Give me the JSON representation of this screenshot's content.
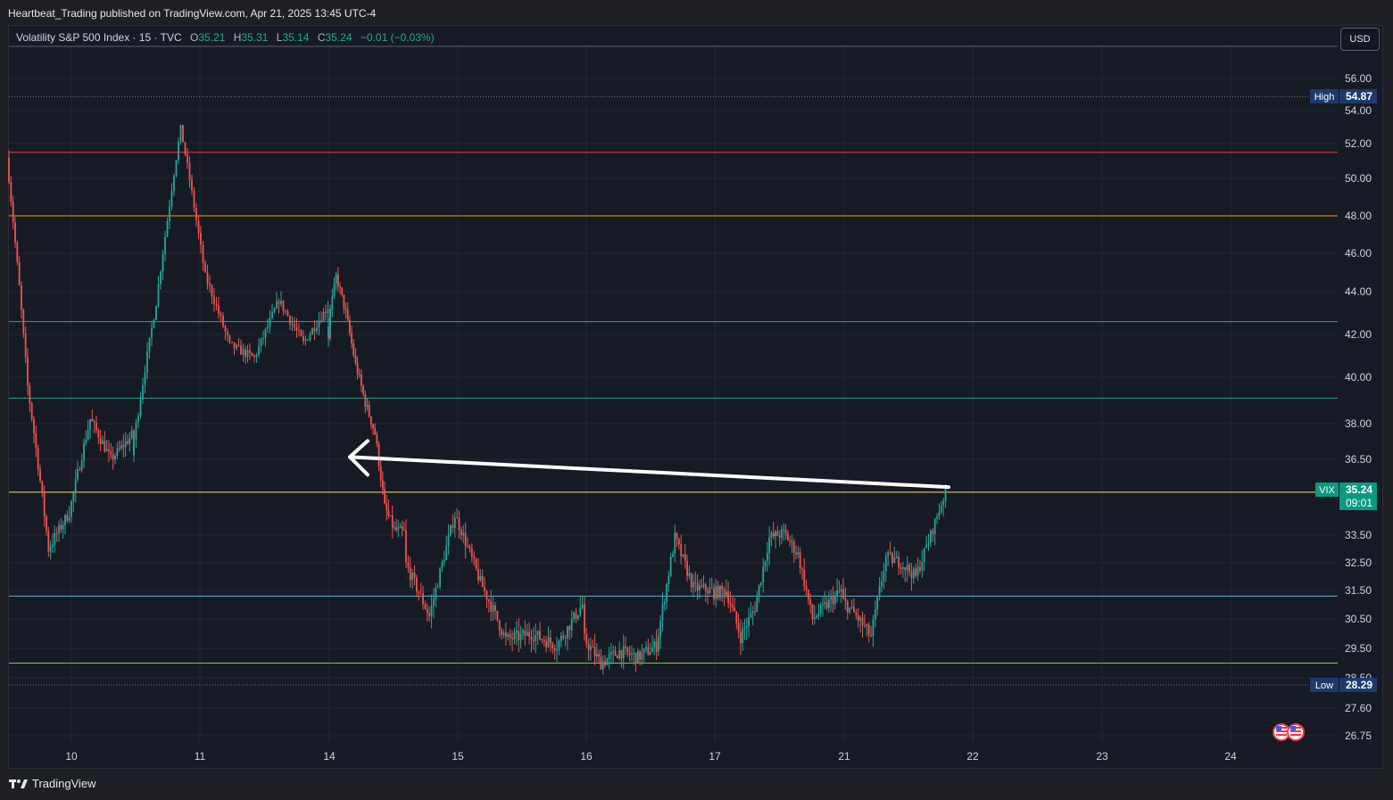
{
  "header": {
    "publisher_line": "Heartbeat_Trading published on TradingView.com, Apr 21, 2025 13:45 UTC-4"
  },
  "legend": {
    "symbol": "Volatility S&P 500 Index · 15 · TVC",
    "open_label": "O",
    "open_value": "35.21",
    "high_label": "H",
    "high_value": "35.31",
    "low_label": "L",
    "low_value": "35.14",
    "close_label": "C",
    "close_value": "35.24",
    "change": "−0.01 (−0.03%)"
  },
  "currency_button": "USD",
  "footer": {
    "brand": "TradingView",
    "logo_icon": "tradingview-logo-icon"
  },
  "colors": {
    "up": "#26a69a",
    "down": "#ef5350",
    "background": "#161a25",
    "grid": "#232632",
    "price_tag": "#089981",
    "extreme_tag": "#1c3a6b"
  },
  "chart_data": {
    "type": "candlestick",
    "symbol": "VIX",
    "interval": "15",
    "y_ticks": [
      "56.00",
      "54.00",
      "52.00",
      "50.00",
      "48.00",
      "46.00",
      "44.00",
      "42.00",
      "40.00",
      "38.00",
      "36.50",
      "33.50",
      "32.50",
      "31.50",
      "30.50",
      "29.50",
      "28.50",
      "27.60",
      "26.75"
    ],
    "x_ticks": [
      "10",
      "11",
      "14",
      "15",
      "16",
      "17",
      "21",
      "22",
      "23",
      "24"
    ],
    "high_marker": {
      "label": "High",
      "value": "54.87"
    },
    "low_marker": {
      "label": "Low",
      "value": "28.29"
    },
    "last_price": {
      "label": "VIX",
      "value": "35.24",
      "countdown": "09:01"
    },
    "horizontal_lines": [
      {
        "price": 51.5,
        "color": "#f23645"
      },
      {
        "price": 48.0,
        "color": "#ff9800"
      },
      {
        "price": 42.6,
        "color": "#26a69a"
      },
      {
        "price": 39.1,
        "color": "#22ab94"
      },
      {
        "price": 35.2,
        "color": "#f5e74e"
      },
      {
        "price": 31.3,
        "color": "#5fb4d6"
      },
      {
        "price": 29.0,
        "color": "#8bc34a"
      }
    ],
    "annotation": {
      "type": "arrow",
      "color": "#ffffff",
      "from": {
        "day": "21",
        "price": 35.4
      },
      "to": {
        "day": "14",
        "price": 36.6
      }
    },
    "path": [
      {
        "day": "10",
        "price": 51.2
      },
      {
        "day": "10",
        "price": 39.6
      },
      {
        "day": "10",
        "price": 33.0
      },
      {
        "day": "10",
        "price": 34.4
      },
      {
        "day": "10",
        "price": 38.2
      },
      {
        "day": "10",
        "price": 36.5
      },
      {
        "day": "10",
        "price": 37.5
      },
      {
        "day": "11",
        "price": 36.7
      },
      {
        "day": "11",
        "price": 43.5
      },
      {
        "day": "11",
        "price": 52.9
      },
      {
        "day": "11",
        "price": 44.8
      },
      {
        "day": "11",
        "price": 41.5
      },
      {
        "day": "11",
        "price": 40.9
      },
      {
        "day": "11",
        "price": 43.6
      },
      {
        "day": "11",
        "price": 41.6
      },
      {
        "day": "11",
        "price": 43.3
      },
      {
        "day": "14",
        "price": 41.9
      },
      {
        "day": "14",
        "price": 44.8
      },
      {
        "day": "14",
        "price": 43.0
      },
      {
        "day": "14",
        "price": 40.6
      },
      {
        "day": "14",
        "price": 38.9
      },
      {
        "day": "14",
        "price": 37.6
      },
      {
        "day": "14",
        "price": 34.6
      },
      {
        "day": "14",
        "price": 33.7
      },
      {
        "day": "14",
        "price": 33.6
      },
      {
        "day": "15",
        "price": 32.6
      },
      {
        "day": "15",
        "price": 30.6
      },
      {
        "day": "15",
        "price": 34.3
      },
      {
        "day": "15",
        "price": 31.8
      },
      {
        "day": "15",
        "price": 29.8
      },
      {
        "day": "15",
        "price": 30.0
      },
      {
        "day": "15",
        "price": 29.6
      },
      {
        "day": "15",
        "price": 31.0
      },
      {
        "day": "16",
        "price": 29.9
      },
      {
        "day": "16",
        "price": 29.0
      },
      {
        "day": "16",
        "price": 29.4
      },
      {
        "day": "16",
        "price": 29.2
      },
      {
        "day": "16",
        "price": 29.6
      },
      {
        "day": "16",
        "price": 33.4
      },
      {
        "day": "16",
        "price": 31.6
      },
      {
        "day": "16",
        "price": 31.5
      },
      {
        "day": "17",
        "price": 31.4
      },
      {
        "day": "17",
        "price": 31.5
      },
      {
        "day": "17",
        "price": 29.9
      },
      {
        "day": "17",
        "price": 30.9
      },
      {
        "day": "17",
        "price": 33.4
      },
      {
        "day": "17",
        "price": 33.6
      },
      {
        "day": "17",
        "price": 32.8
      },
      {
        "day": "17",
        "price": 30.5
      },
      {
        "day": "17",
        "price": 31.0
      },
      {
        "day": "17",
        "price": 31.5
      },
      {
        "day": "21",
        "price": 31.2
      },
      {
        "day": "21",
        "price": 30.6
      },
      {
        "day": "21",
        "price": 29.9
      },
      {
        "day": "21",
        "price": 32.7
      },
      {
        "day": "21",
        "price": 32.5
      },
      {
        "day": "21",
        "price": 32.0
      },
      {
        "day": "21",
        "price": 33.5
      },
      {
        "day": "21",
        "price": 35.24
      }
    ]
  }
}
